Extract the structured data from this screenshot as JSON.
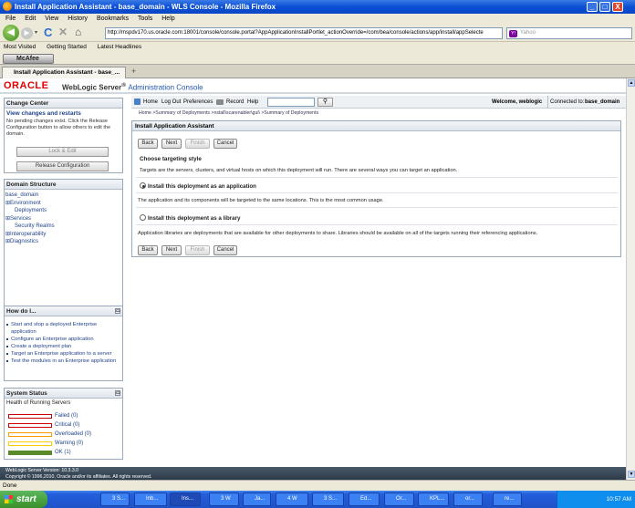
{
  "window": {
    "title": "Install Application Assistant - base_domain - WLS Console - Mozilla Firefox",
    "minimize": "_",
    "maximize": "□",
    "close": "X"
  },
  "menu": [
    "File",
    "Edit",
    "View",
    "History",
    "Bookmarks",
    "Tools",
    "Help"
  ],
  "nav": {
    "url": "http://mspdv170.us.oracle.com:18001/console/console.portal?AppApplicationInstallPortlet_actionOverride=/com/bea/console/actions/app/install/appSelecte",
    "search_placeholder": "Yahoo"
  },
  "bookmarks": [
    "Most Visited",
    "Getting Started",
    "Latest Headlines"
  ],
  "mcafee": "McAfee",
  "tab": {
    "label": "Install Application Assistant - base_...",
    "new": "+"
  },
  "header": {
    "logo": "ORACLE",
    "product": "WebLogic Server",
    "reg": "®",
    "console": "Administration Console"
  },
  "toolbar": {
    "items": [
      "Home",
      "Log Out",
      "Preferences",
      "Record",
      "Help"
    ],
    "welcome": "Welcome, weblogic",
    "connected_label": "Connected to:",
    "domain": "base_domain"
  },
  "breadcrumb": "Home >Summary of Deployments >nstall\\scarenabler\\gui\\ >Summary of Deployments",
  "change_center": {
    "title": "Change Center",
    "link": "View changes and restarts",
    "text": "No pending changes exist. Click the Release Configuration button to allow others to edit the domain.",
    "lock_btn": "Lock & Edit",
    "release_btn": "Release Configuration"
  },
  "domain_structure": {
    "title": "Domain Structure",
    "items": [
      {
        "label": "base_domain",
        "prefix": ""
      },
      {
        "label": "Environment",
        "prefix": "⊞"
      },
      {
        "label": "Deployments",
        "prefix": ""
      },
      {
        "label": "Services",
        "prefix": "⊞"
      },
      {
        "label": "Security Realms",
        "prefix": ""
      },
      {
        "label": "Interoperability",
        "prefix": "⊞"
      },
      {
        "label": "Diagnostics",
        "prefix": "⊞"
      }
    ]
  },
  "how_do_i": {
    "title": "How do I...",
    "items": [
      "Start and stop a deployed Enterprise application",
      "Configure an Enterprise application",
      "Create a deployment plan",
      "Target an Enterprise application to a server",
      "Test the modules in an Enterprise application"
    ]
  },
  "system_status": {
    "title": "System Status",
    "subtitle": "Health of Running Servers",
    "rows": [
      {
        "label": "Failed (0)",
        "fill": 0,
        "color": "#cc0000"
      },
      {
        "label": "Critical (0)",
        "fill": 0,
        "color": "#cc0000"
      },
      {
        "label": "Overloaded (0)",
        "fill": 0,
        "color": "#ff9900"
      },
      {
        "label": "Warning (0)",
        "fill": 0,
        "color": "#ffcc00"
      },
      {
        "label": "OK (1)",
        "fill": 1,
        "color": "#5a8a2a"
      }
    ]
  },
  "main": {
    "title": "Install Application Assistant",
    "buttons": {
      "back": "Back",
      "next": "Next",
      "finish": "Finish",
      "cancel": "Cancel"
    },
    "section": "Choose targeting style",
    "intro": "Targets are the servers, clusters, and virtual hosts on which this deployment will run. There are several ways you can target an application.",
    "opt1": "Install this deployment as an application",
    "opt1_desc": "The application and its components will be targeted to the same locations. This is the most common usage.",
    "opt2": "Install this deployment as a library",
    "opt2_desc": "Application libraries are deployments that are available for other deployments to share. Libraries should be available on all of the targets running their referencing applications."
  },
  "footer": {
    "version": "WebLogic Server Version: 10.3.3.0",
    "copyright": "Copyright © 1996,2010, Oracle and/or its affiliates. All rights reserved."
  },
  "status": "Done",
  "taskbar": {
    "start": "start",
    "tasks": [
      "3 S...",
      "Inb...",
      "Ins...",
      "3 W",
      "Ja...",
      "4 W",
      "3 S...",
      "Ed...",
      "Or...",
      "KPL...",
      "or...",
      "re..."
    ],
    "clock": "10:57 AM"
  }
}
